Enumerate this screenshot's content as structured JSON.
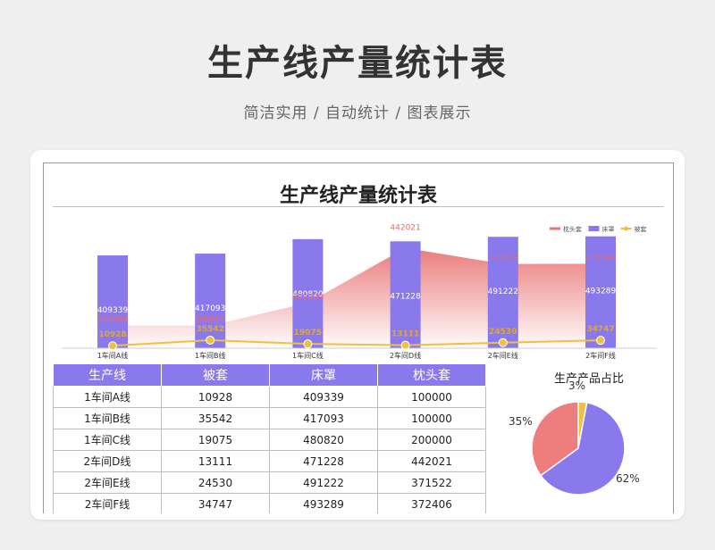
{
  "page": {
    "title": "生产线产量统计表",
    "subtitle": "简洁实用 / 自动统计 / 图表展示"
  },
  "sheet": {
    "title": "生产线产量统计表"
  },
  "chart_data": [
    {
      "type": "bar",
      "categories": [
        "1车间A线",
        "1车间B线",
        "1车间C线",
        "2车间D线",
        "2车间E线",
        "2车间F线"
      ],
      "series": [
        {
          "name": "枕头套",
          "kind": "area",
          "color": "#ea7575",
          "values": [
            100000,
            100000,
            200000,
            442021,
            371522,
            372406
          ]
        },
        {
          "name": "床罩",
          "kind": "bar",
          "color": "#8a79ec",
          "values": [
            409339,
            417093,
            480820,
            471228,
            491222,
            493289
          ]
        },
        {
          "name": "被套",
          "kind": "line",
          "color": "#efc141",
          "values": [
            10928,
            35542,
            19075,
            13111,
            24530,
            34747
          ]
        }
      ],
      "ylim": [
        0,
        500000
      ],
      "legend": "top-right",
      "grid": false
    },
    {
      "type": "pie",
      "title": "生产产品占比",
      "labels": [
        "被套",
        "床罩",
        "枕头套"
      ],
      "values": [
        3,
        62,
        35
      ],
      "value_labels": [
        "3%",
        "62%",
        "35%"
      ],
      "colors": [
        "#efc141",
        "#8a79ec",
        "#ee7d7d"
      ]
    }
  ],
  "table": {
    "headers": [
      "生产线",
      "被套",
      "床罩",
      "枕头套"
    ],
    "rows": [
      [
        "1车间A线",
        "10928",
        "409339",
        "100000"
      ],
      [
        "1车间B线",
        "35542",
        "417093",
        "100000"
      ],
      [
        "1车间C线",
        "19075",
        "480820",
        "200000"
      ],
      [
        "2车间D线",
        "13111",
        "471228",
        "442021"
      ],
      [
        "2车间E线",
        "24530",
        "491222",
        "371522"
      ],
      [
        "2车间F线",
        "34747",
        "493289",
        "372406"
      ]
    ]
  }
}
